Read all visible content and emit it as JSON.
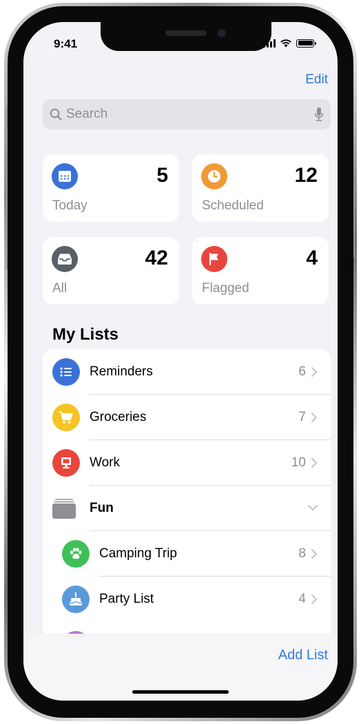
{
  "status_bar": {
    "time": "9:41"
  },
  "nav": {
    "edit_label": "Edit"
  },
  "search": {
    "placeholder": "Search"
  },
  "smart_lists": [
    {
      "label": "Today",
      "count": "5",
      "icon": "calendar-icon",
      "color": "#3a72d8"
    },
    {
      "label": "Scheduled",
      "count": "12",
      "icon": "clock-icon",
      "color": "#f09a37"
    },
    {
      "label": "All",
      "count": "42",
      "icon": "tray-icon",
      "color": "#5a6068"
    },
    {
      "label": "Flagged",
      "count": "4",
      "icon": "flag-icon",
      "color": "#e8463c"
    }
  ],
  "my_lists": {
    "title": "My Lists",
    "items": [
      {
        "label": "Reminders",
        "count": "6",
        "icon": "list-bullet-icon",
        "color": "#3a72d8"
      },
      {
        "label": "Groceries",
        "count": "7",
        "icon": "cart-icon",
        "color": "#f5c324"
      },
      {
        "label": "Work",
        "count": "10",
        "icon": "desktop-icon",
        "color": "#e8463c"
      },
      {
        "label": "Fun",
        "icon": "folder-stack-icon",
        "color": "#8e8e93",
        "expanded": true
      },
      {
        "label": "Camping Trip",
        "count": "8",
        "icon": "paw-icon",
        "color": "#3fbf57"
      },
      {
        "label": "Party List",
        "count": "4",
        "icon": "cake-icon",
        "color": "#5a9ad8"
      }
    ]
  },
  "toolbar": {
    "add_list_label": "Add List"
  },
  "colors": {
    "accent": "#2f7bd6",
    "background": "#f2f2f7"
  }
}
